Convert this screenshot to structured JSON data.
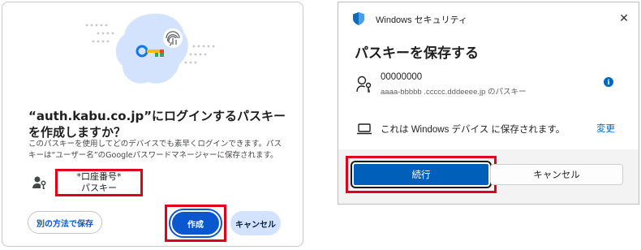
{
  "google_dialog": {
    "title": "“auth.kabu.co.jp”にログインするパスキーを作成しますか？",
    "body": "このパスキーを使用してどのデバイスでも素早くログインできます。パスキーは“ユーザー名”のGoogleパスワードマネージャーに保存されます。",
    "account_name": "*口座番号*",
    "account_subtitle": "パスキー",
    "other_method_label": "別の方法で保存",
    "create_label": "作成",
    "cancel_label": "キャンセル",
    "illustration_icons": [
      "key-icon",
      "fingerprint-icon"
    ]
  },
  "windows_dialog": {
    "app_title": "Windows セキュリティ",
    "heading": "パスキーを保存する",
    "account_name": "00000000",
    "account_description": "aaaa-bbbbb .ccccc.dddeeee.jp のパスキー",
    "device_text": "これは Windows デバイス に保存されます。",
    "change_label": "変更",
    "continue_label": "続行",
    "cancel_label": "キャンセル",
    "close_label": "✕",
    "info_label": "i"
  },
  "colors": {
    "highlight": "#e0001b",
    "google_primary": "#0b57d0",
    "google_tonal": "#d3e3fd",
    "windows_accent": "#005fb8"
  }
}
